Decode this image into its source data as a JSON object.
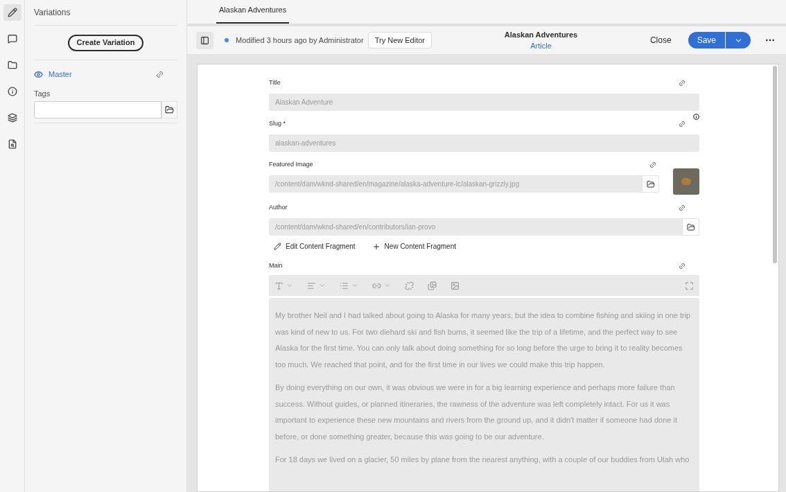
{
  "rail": [
    {
      "kind": "edit",
      "selected": true
    },
    {
      "kind": "comments",
      "selected": false
    },
    {
      "kind": "folder",
      "selected": false
    },
    {
      "kind": "info",
      "selected": false
    },
    {
      "kind": "layers",
      "selected": false
    },
    {
      "kind": "search",
      "selected": false
    }
  ],
  "panel": {
    "title": "Variations",
    "create_button": "Create Variation",
    "variation": "Master",
    "tags_label": "Tags"
  },
  "tabs": [
    {
      "label": "Alaskan Adventures",
      "selected": true
    }
  ],
  "toolbar": {
    "status": "Modified 3 hours ago by Administrator",
    "try_button": "Try New Editor",
    "title": "Alaskan Adventures",
    "subtitle": "Article",
    "close": "Close",
    "save": "Save"
  },
  "fields": [
    {
      "kind": "text",
      "label": "Title",
      "value": "Alaskan Adventure",
      "info": false
    },
    {
      "kind": "text",
      "label": "Slug *",
      "value": "alaskan-adventures",
      "info": true
    },
    {
      "kind": "image",
      "label": "Featured Image",
      "value": "/content/dam/wknd-shared/en/magazine/alaska-adventure-lc/alaskan-grizzly.jpg",
      "info": false
    },
    {
      "kind": "path",
      "label": "Author",
      "value": "/content/dam/wknd-shared/en/contributors/ian-provo",
      "info": false
    }
  ],
  "fragment_actions": [
    {
      "kind": "edit",
      "label": "Edit Content Fragment"
    },
    {
      "kind": "new",
      "label": "New Content Fragment"
    }
  ],
  "main": {
    "label": "Main",
    "paragraphs": [
      "My brother Neil and I had talked about going to Alaska for many years, but the idea to combine fishing and skiing in one trip was kind of new to us. For two diehard ski and fish bums, it seemed like the trip of a lifetime, and the perfect way to see Alaska for the first time. You can only talk about doing something for so long before the urge to bring it to reality becomes too much. We reached that point, and for the first time in our lives we could make this trip happen.",
      "By doing everything on our own, it was obvious we were in for a big learning experience and perhaps more failure than success. Without guides, or planned itineraries, the rawness of the adventure was left completely intact. For us it was important to experience these new mountains and rivers from the ground up, and it didn't matter if someone had done it before, or done something greater, because this was going to be our adventure.",
      "For 18 days we lived on a glacier, 50 miles by plane from the nearest anything, with a couple of our buddies from Utah who"
    ]
  }
}
